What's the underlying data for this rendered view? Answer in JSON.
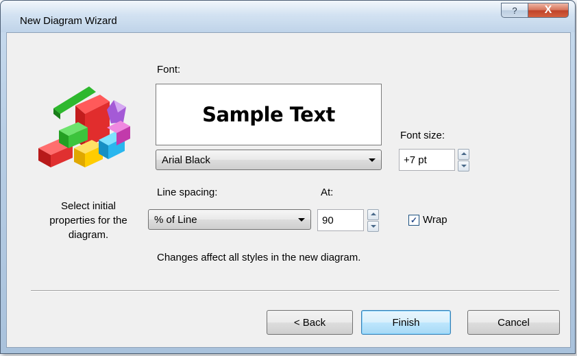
{
  "window": {
    "title": "New Diagram Wizard",
    "help_glyph": "?",
    "close_glyph": "X"
  },
  "sidebar": {
    "logo_icon": "colorful-blocks-icon",
    "description": "Select initial properties for the diagram."
  },
  "font": {
    "label": "Font:",
    "preview_text": "Sample Text",
    "selected": "Arial Black",
    "size_label": "Font size:",
    "size_value": "+7 pt"
  },
  "line_spacing": {
    "label": "Line spacing:",
    "selected": "% of Line",
    "at_label": "At:",
    "at_value": "90"
  },
  "wrap": {
    "label": "Wrap",
    "checked": true
  },
  "note": "Changes affect all styles in the new diagram.",
  "buttons": {
    "back": "< Back",
    "finish": "Finish",
    "cancel": "Cancel"
  },
  "colors": {
    "title_bar": "#b7cde4",
    "default_button": "#bee6fd",
    "close_button": "#c0432a"
  }
}
